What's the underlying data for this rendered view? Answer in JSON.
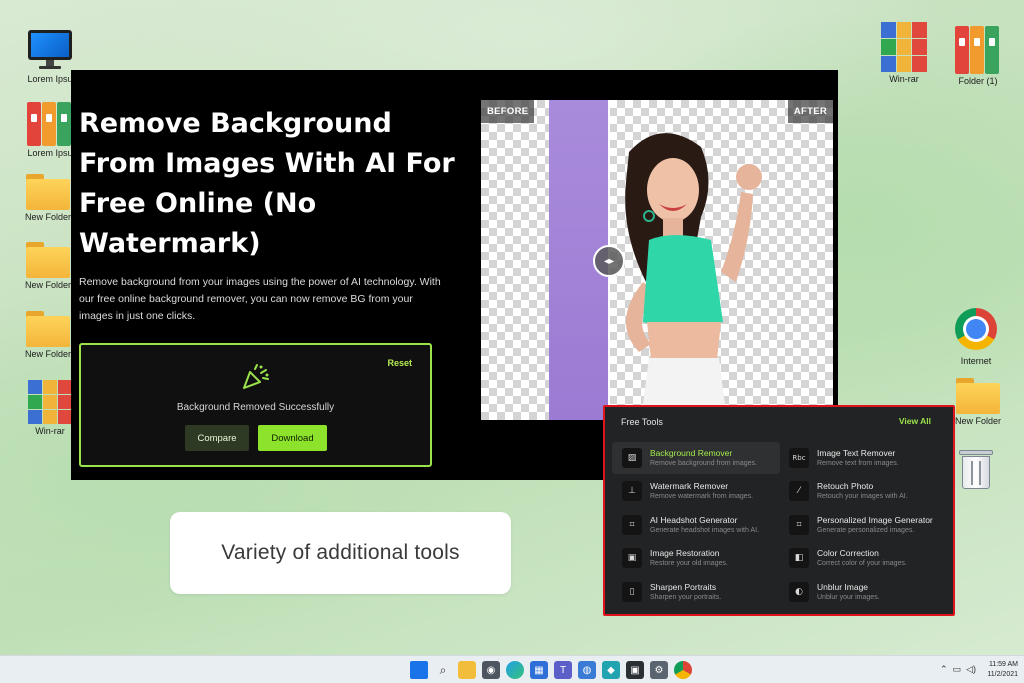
{
  "desktop": {
    "left_icons": [
      {
        "label": "Lorem Ipsu",
        "icon": "computer-icon"
      },
      {
        "label": "Lorem Ipsu",
        "icon": "binders-icon"
      },
      {
        "label": "New Folder",
        "icon": "folder-icon"
      },
      {
        "label": "New Folder",
        "icon": "folder-icon"
      },
      {
        "label": "New Folder",
        "icon": "folder-icon"
      },
      {
        "label": "Win-rar",
        "icon": "winrar-icon"
      }
    ],
    "right_icons": [
      {
        "label": "Win-rar",
        "icon": "winrar-icon"
      },
      {
        "label": "Folder (1)",
        "icon": "binders-icon"
      },
      {
        "label": "Internet",
        "icon": "chrome-icon"
      },
      {
        "label": "New Folder",
        "icon": "folder-icon"
      },
      {
        "label": "",
        "icon": "recycle-bin-icon"
      }
    ]
  },
  "app": {
    "title": "Remove Background From Images With AI For Free Online (No Watermark)",
    "description": "Remove background from your images using the power of AI technology. With our free online background remover, you can now remove BG from your images in just one clicks.",
    "result": {
      "reset_label": "Reset",
      "message": "Background Removed Successfully",
      "compare_label": "Compare",
      "download_label": "Download"
    },
    "preview": {
      "before_label": "BEFORE",
      "after_label": "AFTER"
    }
  },
  "tools_panel": {
    "heading": "Free Tools",
    "view_all_label": "View All",
    "tools": [
      {
        "name": "Background Remover",
        "desc": "Remove background from images.",
        "icon": "stripes-icon",
        "active": true
      },
      {
        "name": "Image Text Remover",
        "desc": "Remove text from images.",
        "icon": "text-abc-icon",
        "active": false
      },
      {
        "name": "Watermark Remover",
        "desc": "Remove watermark from images.",
        "icon": "stamp-icon",
        "active": false
      },
      {
        "name": "Retouch Photo",
        "desc": "Retouch your images with AI.",
        "icon": "magic-wand-icon",
        "active": false
      },
      {
        "name": "AI Headshot Generator",
        "desc": "Generate headshot images with AI.",
        "icon": "face-scan-icon",
        "active": false
      },
      {
        "name": "Personalized Image Generator",
        "desc": "Generate personalized images.",
        "icon": "portrait-scan-icon",
        "active": false
      },
      {
        "name": "Image Restoration",
        "desc": "Restore your old images.",
        "icon": "image-icon",
        "active": false
      },
      {
        "name": "Color Correction",
        "desc": "Correct color of your images.",
        "icon": "color-swatch-icon",
        "active": false
      },
      {
        "name": "Sharpen Portraits",
        "desc": "Sharpen your portraits.",
        "icon": "portrait-frame-icon",
        "active": false
      },
      {
        "name": "Unblur Image",
        "desc": "Unblur your images.",
        "icon": "half-circle-icon",
        "active": false
      }
    ]
  },
  "caption": "Variety of additional tools",
  "taskbar": {
    "apps": [
      "windows-start-icon",
      "search-icon",
      "file-explorer-icon",
      "camera-icon",
      "edge-icon",
      "store-icon",
      "teams-icon",
      "people-icon",
      "app-icon",
      "app-icon",
      "settings-icon",
      "chrome-icon"
    ],
    "time": "11:59 AM",
    "date": "11/2/2021"
  },
  "colors": {
    "accent_green": "#8de22c",
    "highlight_red": "#e0131c",
    "panel_dark": "#222324"
  }
}
